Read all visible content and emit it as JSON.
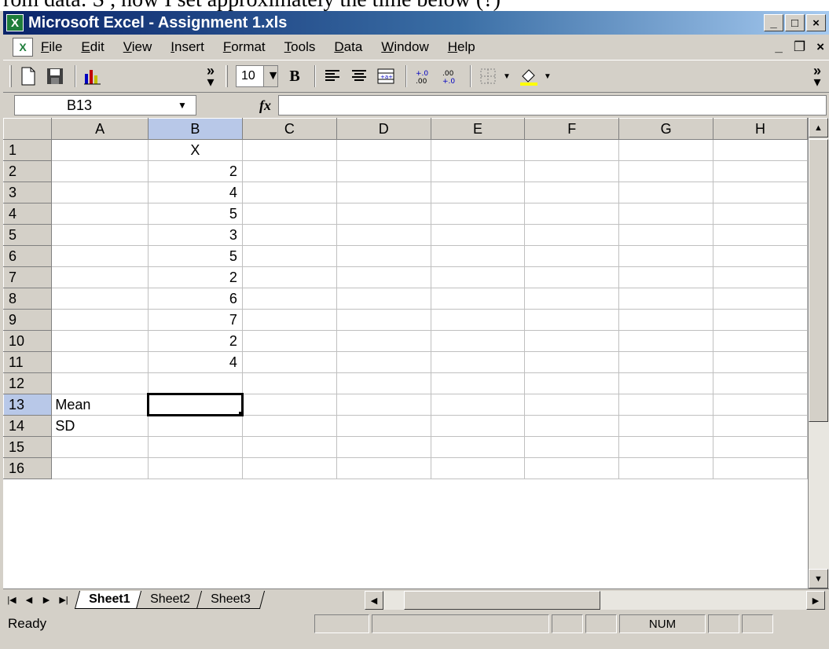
{
  "top_crop_text": "rom data: S , now I set approximately the time below (?)",
  "window": {
    "title": "Microsoft Excel - Assignment 1.xls",
    "app_icon": "excel-icon"
  },
  "menu": [
    "File",
    "Edit",
    "View",
    "Insert",
    "Format",
    "Tools",
    "Data",
    "Window",
    "Help"
  ],
  "toolbar": {
    "font_size": "10",
    "icons": [
      "new-doc-icon",
      "save-icon",
      "chart-icon",
      "bold-icon",
      "align-left-icon",
      "align-center-icon",
      "merge-center-icon",
      "increase-decimal-icon",
      "decrease-decimal-icon",
      "borders-icon",
      "fill-color-icon"
    ]
  },
  "formula_bar": {
    "name_box": "B13",
    "fx_label": "fx",
    "value": ""
  },
  "grid": {
    "columns": [
      "A",
      "B",
      "C",
      "D",
      "E",
      "F",
      "G",
      "H"
    ],
    "selected_column": "B",
    "rows": [
      {
        "num": "1",
        "a": "",
        "b": "X"
      },
      {
        "num": "2",
        "a": "",
        "b": "2"
      },
      {
        "num": "3",
        "a": "",
        "b": "4"
      },
      {
        "num": "4",
        "a": "",
        "b": "5"
      },
      {
        "num": "5",
        "a": "",
        "b": "3"
      },
      {
        "num": "6",
        "a": "",
        "b": "5"
      },
      {
        "num": "7",
        "a": "",
        "b": "2"
      },
      {
        "num": "8",
        "a": "",
        "b": "6"
      },
      {
        "num": "9",
        "a": "",
        "b": "7"
      },
      {
        "num": "10",
        "a": "",
        "b": "2"
      },
      {
        "num": "11",
        "a": "",
        "b": "4"
      },
      {
        "num": "12",
        "a": "",
        "b": ""
      },
      {
        "num": "13",
        "a": "Mean",
        "b": ""
      },
      {
        "num": "14",
        "a": "SD",
        "b": ""
      },
      {
        "num": "15",
        "a": "",
        "b": ""
      },
      {
        "num": "16",
        "a": "",
        "b": ""
      }
    ]
  },
  "sheets": [
    "Sheet1",
    "Sheet2",
    "Sheet3"
  ],
  "active_sheet": "Sheet1",
  "status": {
    "text": "Ready",
    "num": "NUM"
  },
  "colors": {
    "title_start": "#0a246a",
    "title_end": "#a6caf0",
    "selection_header": "#b8c8e8",
    "chrome": "#d4d0c8"
  }
}
